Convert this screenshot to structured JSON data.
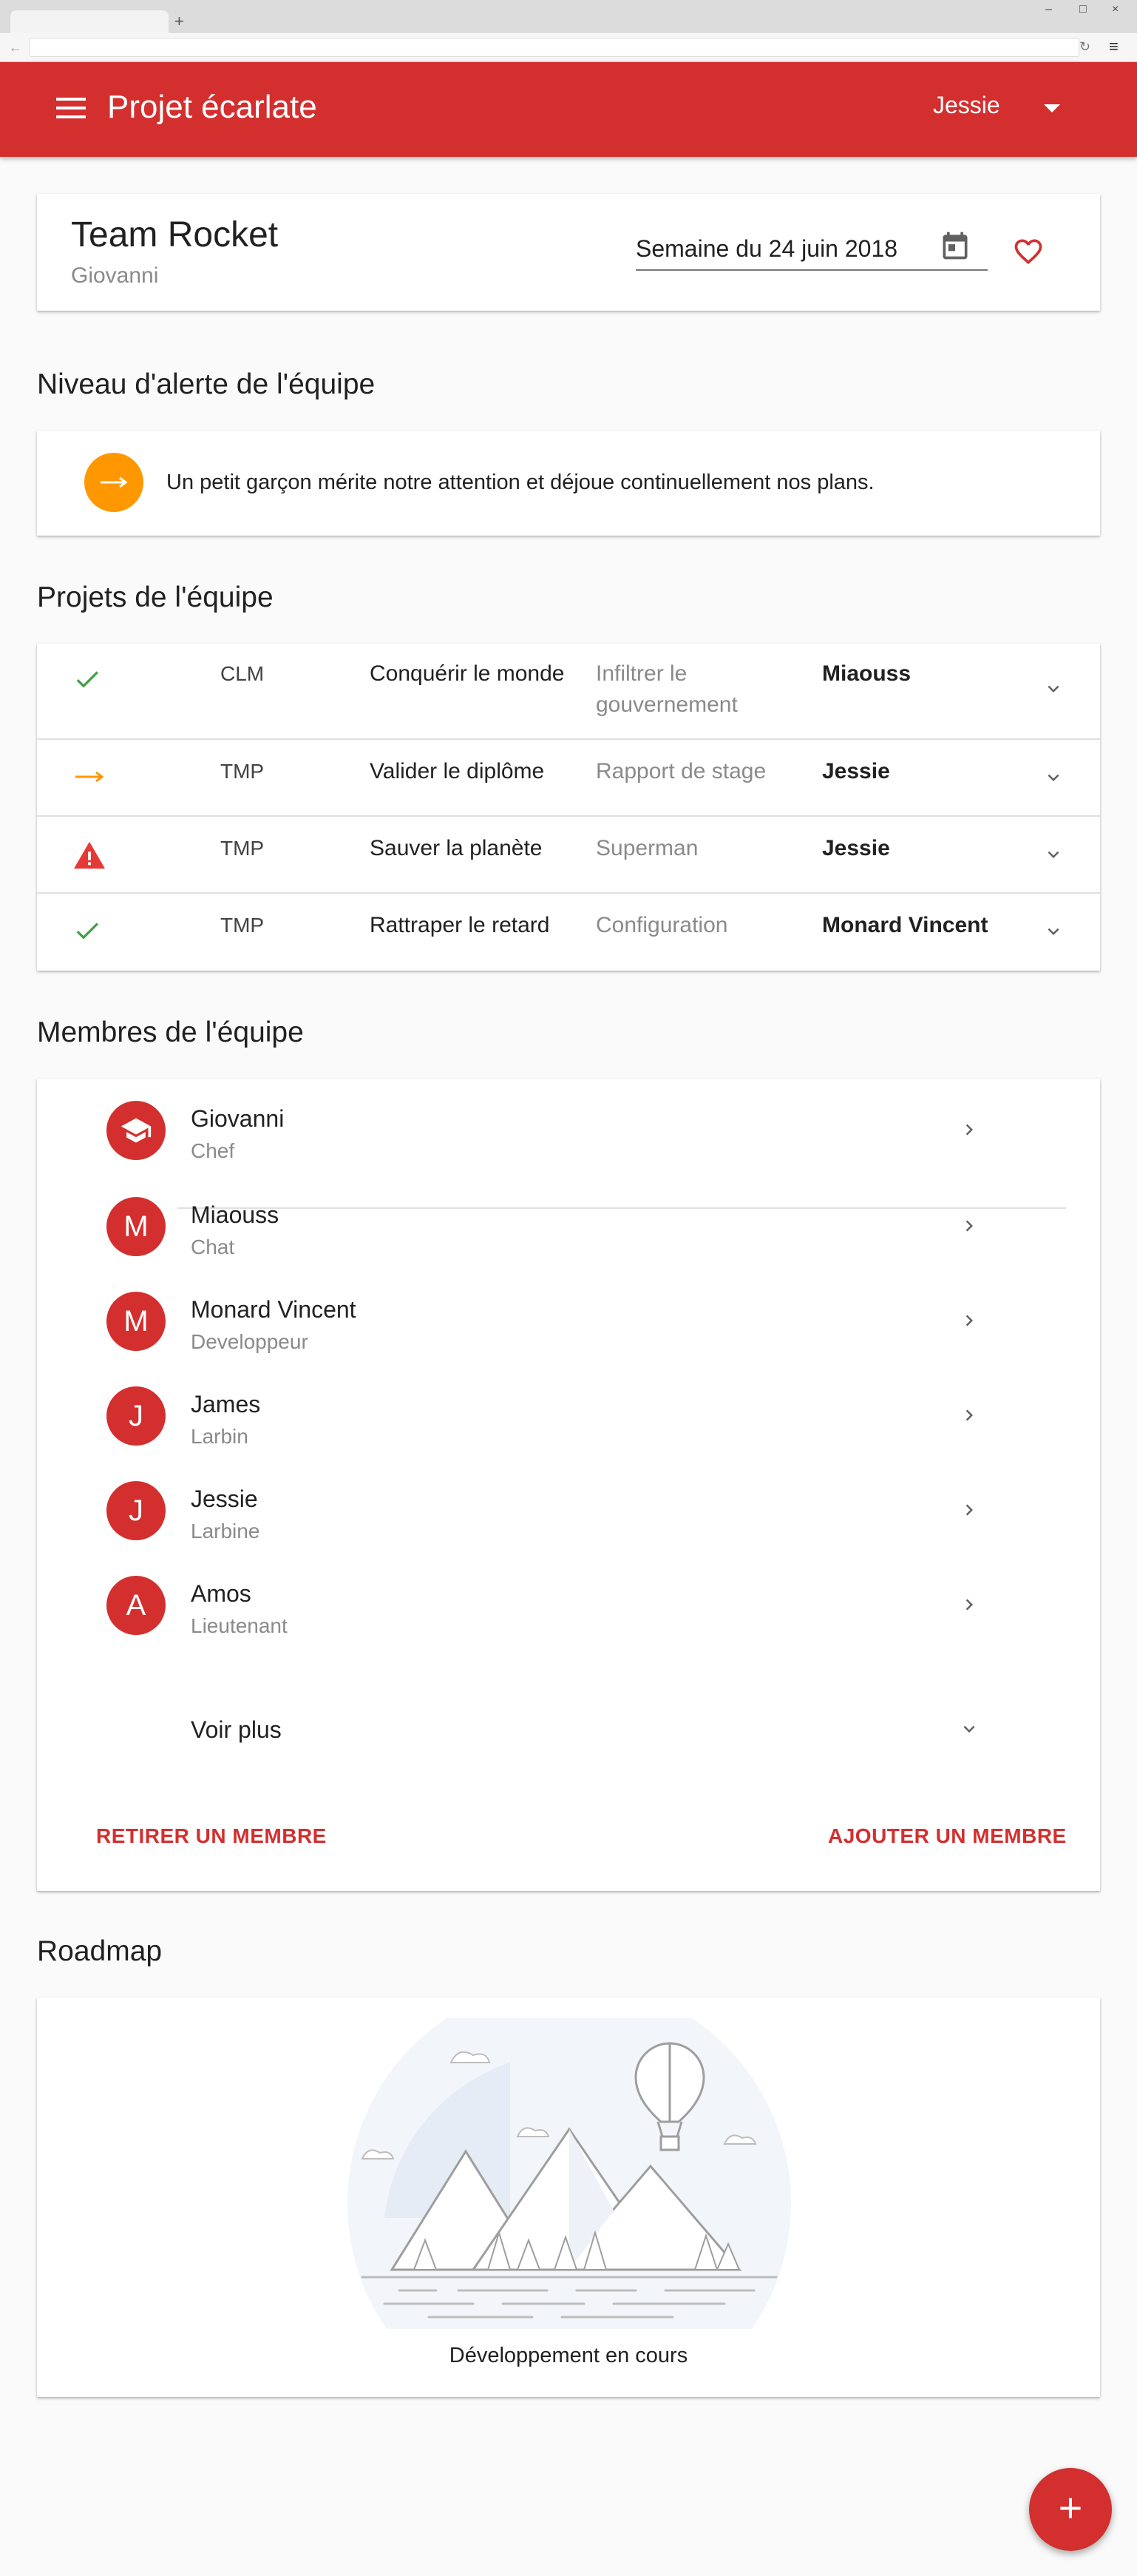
{
  "browser": {
    "new_tab_glyph": "+",
    "back_glyph": "←",
    "reload_glyph": "↻",
    "menu_glyph": "≡",
    "minimize_glyph": "–",
    "maximize_glyph": "□",
    "close_glyph": "×"
  },
  "appbar": {
    "title": "Projet écarlate",
    "user": "Jessie",
    "color": "#d32f2f"
  },
  "team": {
    "name": "Team Rocket",
    "owner": "Giovanni",
    "week_label": "Semaine du 24 juin 2018"
  },
  "alert_section": {
    "title": "Niveau d'alerte de l'équipe",
    "message": "Un petit garçon mérite notre attention et déjoue continuellement nos plans.",
    "status_color": "#ff9800"
  },
  "projects_section": {
    "title": "Projets de l'équipe",
    "rows": [
      {
        "status": "ok",
        "code": "CLM",
        "name": "Conquérir le monde",
        "subtitle": "Infiltrer le gouvernement",
        "owner": "Miaouss"
      },
      {
        "status": "warning",
        "code": "TMP",
        "name": "Valider le diplôme",
        "subtitle": "Rapport de stage",
        "owner": "Jessie"
      },
      {
        "status": "danger",
        "code": "TMP",
        "name": "Sauver la planète",
        "subtitle": "Superman",
        "owner": "Jessie"
      },
      {
        "status": "ok",
        "code": "TMP",
        "name": "Rattraper le retard",
        "subtitle": "Configuration",
        "owner": "Monard Vincent"
      }
    ]
  },
  "members_section": {
    "title": "Membres de l'équipe",
    "members": [
      {
        "initial": "",
        "icon": "graduation-cap-icon",
        "name": "Giovanni",
        "role": "Chef"
      },
      {
        "initial": "M",
        "name": "Miaouss",
        "role": "Chat"
      },
      {
        "initial": "M",
        "name": "Monard Vincent",
        "role": "Developpeur"
      },
      {
        "initial": "J",
        "name": "James",
        "role": "Larbin"
      },
      {
        "initial": "J",
        "name": "Jessie",
        "role": "Larbine"
      },
      {
        "initial": "A",
        "name": "Amos",
        "role": "Lieutenant"
      }
    ],
    "see_more": "Voir plus",
    "remove_label": "RETIRER UN MEMBRE",
    "add_label": "AJOUTER UN MEMBRE"
  },
  "roadmap_section": {
    "title": "Roadmap",
    "caption": "Développement en cours"
  },
  "fab": {
    "label": "+"
  },
  "colors": {
    "ok": "#43a047",
    "warning": "#ff9800",
    "danger": "#e53935",
    "accent": "#d32f2f"
  }
}
